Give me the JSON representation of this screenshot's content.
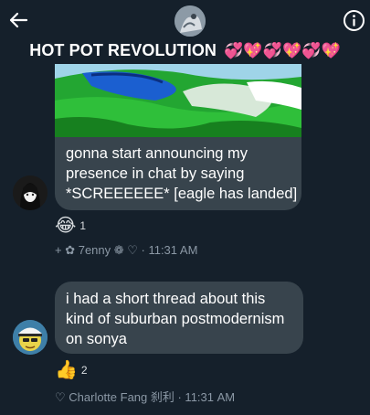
{
  "header": {
    "title": "HOT POT REVOLUTION",
    "title_emoji": "💞💖💞💖💞💖",
    "back_icon": "back-arrow-icon",
    "info_icon": "info-icon"
  },
  "messages": [
    {
      "lines": [
        "gonna start announcing my",
        "presence in chat by saying",
        "*SCREEEEEE* [eagle has landed]"
      ],
      "reaction": {
        "emoji": "😂",
        "count": "1"
      },
      "meta": "+ ✿ 7enny ❁ ♡ · 11:31 AM"
    },
    {
      "lines": [
        "i had a short thread about this",
        "kind of suburban postmodernism",
        "on sonya"
      ],
      "reaction": {
        "emoji": "👍",
        "count": "2"
      },
      "meta": "♡ Charlotte Fang 刹利 · 11:31 AM"
    }
  ],
  "colors": {
    "background": "#15202b",
    "bubble": "#38444d",
    "meta_text": "#8b98a5"
  }
}
